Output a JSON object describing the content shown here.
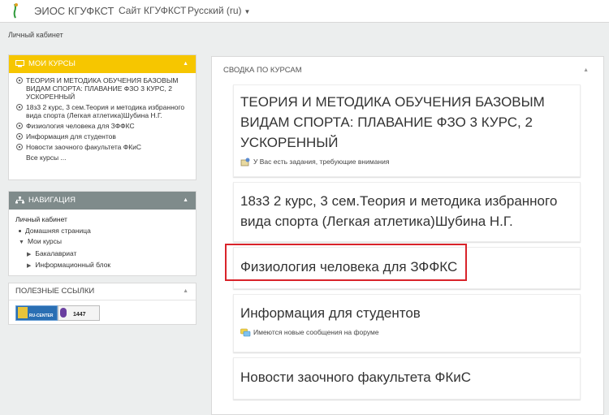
{
  "topbar": {
    "brand": "ЭИОС КГУФКСТ",
    "site_link": "Сайт КГУФКСТ",
    "language": "Русский (ru)"
  },
  "breadcrumb": "Личный кабинет",
  "my_courses": {
    "title": "МОИ КУРСЫ",
    "items": [
      "ТЕОРИЯ И МЕТОДИКА ОБУЧЕНИЯ БАЗОВЫМ ВИДАМ СПОРТА: ПЛАВАНИЕ ФЗО 3 КУРС, 2 УСКОРЕННЫЙ",
      "18з3 2 курс, 3 сем.Теория и методика избранного вида спорта (Легкая атлетика)Шубина Н.Г.",
      "Физиология человека для ЗФФКС",
      "Информация для студентов",
      "Новости заочного факультета ФКиС"
    ],
    "all_courses": "Все курсы ..."
  },
  "navigation": {
    "title": "НАВИГАЦИЯ",
    "dashboard": "Личный кабинет",
    "home": "Домашняя страница",
    "my_courses": "Мои курсы",
    "bachelor": "Бакалавриат",
    "info_block": "Информационный блок"
  },
  "useful_links": {
    "title": "ПОЛЕЗНЫЕ ССЫЛКИ",
    "badge_text": "RU-CENTER",
    "counter": "1447"
  },
  "course_overview": {
    "title": "СВОДКА ПО КУРСАМ",
    "courses": [
      {
        "name": "ТЕОРИЯ И МЕТОДИКА ОБУЧЕНИЯ БАЗОВЫМ ВИДАМ СПОРТА: ПЛАВАНИЕ ФЗО 3 КУРС, 2 УСКОРЕННЫЙ",
        "note": "У Вас есть задания, требующие внимания"
      },
      {
        "name": "18з3 2 курс, 3 сем.Теория и методика избранного вида спорта (Легкая атлетика)Шубина Н.Г.",
        "note": ""
      },
      {
        "name": "Физиология человека для ЗФФКС",
        "note": ""
      },
      {
        "name": "Информация для студентов",
        "note": "Имеются новые сообщения на форуме"
      },
      {
        "name": "Новости заочного факультета ФКиС",
        "note": ""
      }
    ]
  },
  "colors": {
    "accent_yellow": "#f6c600",
    "nav_gray": "#7f8b8b",
    "highlight_red": "#d9232a"
  }
}
